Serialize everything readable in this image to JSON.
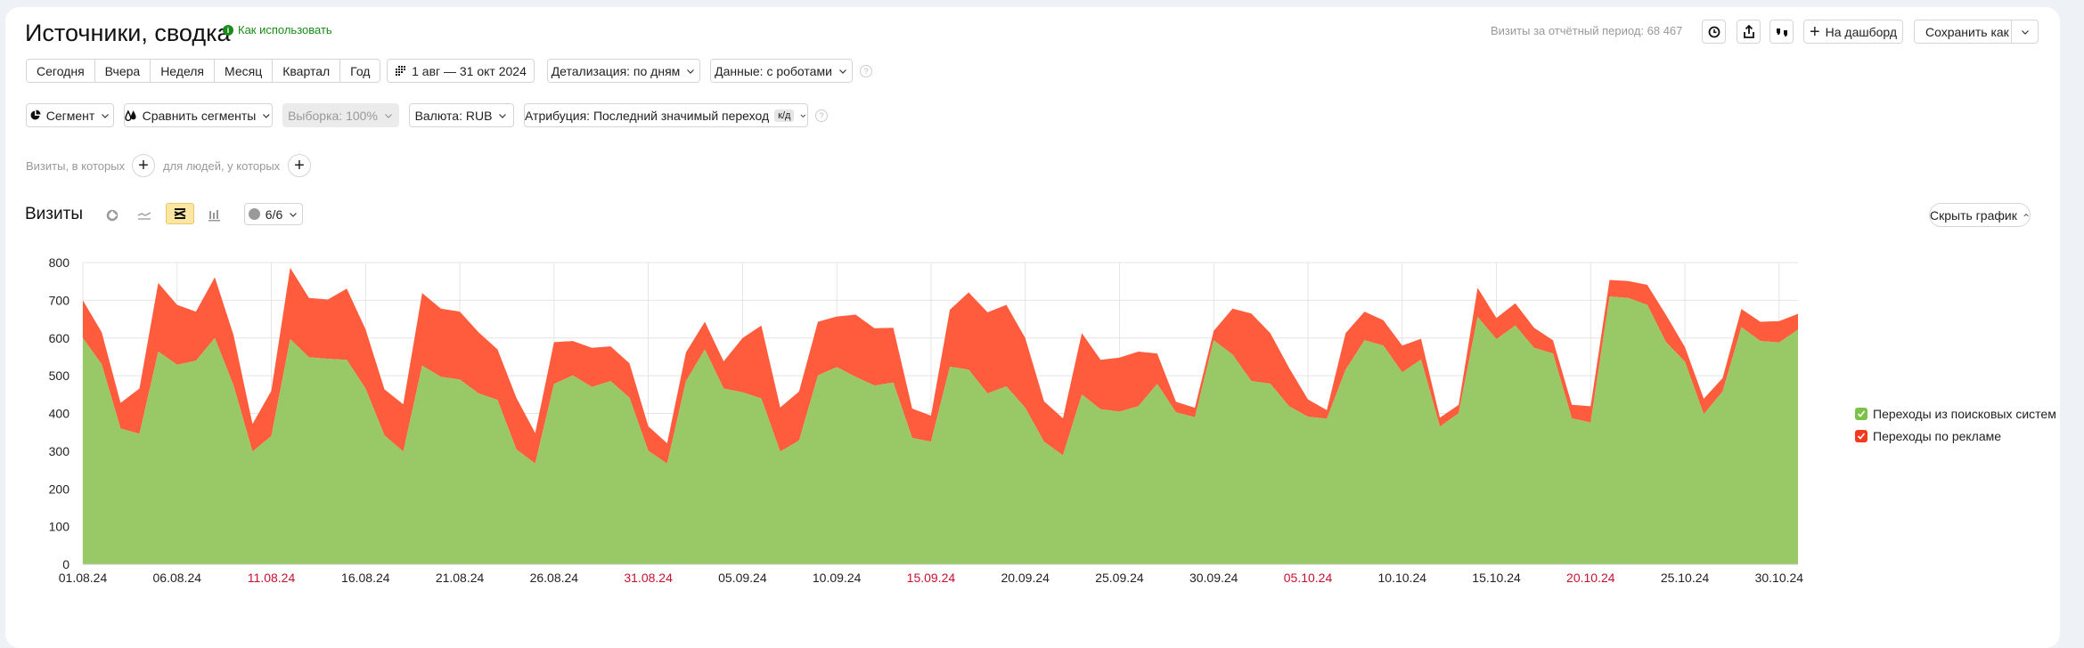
{
  "header": {
    "title": "Источники, сводка",
    "how_to_use": "Как использовать",
    "visits_total": "Визиты за отчётный период: 68 467",
    "add_dashboard": "На дашборд",
    "save_as": "Сохранить как"
  },
  "periods": [
    "Сегодня",
    "Вчера",
    "Неделя",
    "Месяц",
    "Квартал",
    "Год"
  ],
  "filters": {
    "date_range": "1 авг — 31 окт 2024",
    "detail": "Детализация: по дням",
    "data": "Данные: с роботами",
    "segment": "Сегмент",
    "compare": "Сравнить сегменты",
    "sample": "Выборка: 100%",
    "currency": "Валюта: RUB",
    "attribution": "Атрибуция: Последний значимый переход",
    "attribution_badge": "к/д",
    "help": "?"
  },
  "conditions": {
    "visits_where": "Визиты, в которых",
    "people_who": "для людей, у которых"
  },
  "chart_header": {
    "title": "Визиты",
    "comments": "6/6",
    "hide_chart": "Скрыть график",
    "active_view": "stacked-area"
  },
  "colors": {
    "search": "#99c966",
    "ads": "#ff5c3e",
    "holiday_label": "#c8102e",
    "accent": "#fbe7a1"
  },
  "chart_data": {
    "type": "area",
    "stacked": true,
    "ylim": [
      0,
      800
    ],
    "yticks": [
      0,
      100,
      200,
      300,
      400,
      500,
      600,
      700,
      800
    ],
    "grid": true,
    "legend_position": "right",
    "start_date": "01.08.24",
    "xtick_labels": [
      {
        "label": "01.08.24",
        "day": 0,
        "holiday": false
      },
      {
        "label": "06.08.24",
        "day": 5,
        "holiday": false
      },
      {
        "label": "11.08.24",
        "day": 10,
        "holiday": true
      },
      {
        "label": "16.08.24",
        "day": 15,
        "holiday": false
      },
      {
        "label": "21.08.24",
        "day": 20,
        "holiday": false
      },
      {
        "label": "26.08.24",
        "day": 25,
        "holiday": false
      },
      {
        "label": "31.08.24",
        "day": 30,
        "holiday": true
      },
      {
        "label": "05.09.24",
        "day": 35,
        "holiday": false
      },
      {
        "label": "10.09.24",
        "day": 40,
        "holiday": false
      },
      {
        "label": "15.09.24",
        "day": 45,
        "holiday": true
      },
      {
        "label": "20.09.24",
        "day": 50,
        "holiday": false
      },
      {
        "label": "25.09.24",
        "day": 55,
        "holiday": false
      },
      {
        "label": "30.09.24",
        "day": 60,
        "holiday": false
      },
      {
        "label": "05.10.24",
        "day": 65,
        "holiday": true
      },
      {
        "label": "10.10.24",
        "day": 70,
        "holiday": false
      },
      {
        "label": "15.10.24",
        "day": 75,
        "holiday": false
      },
      {
        "label": "20.10.24",
        "day": 80,
        "holiday": true
      },
      {
        "label": "25.10.24",
        "day": 85,
        "holiday": false
      },
      {
        "label": "30.10.24",
        "day": 90,
        "holiday": false
      }
    ],
    "series": [
      {
        "name": "Переходы из поисковых систем",
        "values": [
          600,
          530,
          360,
          346,
          564,
          529,
          540,
          600,
          474,
          299,
          340,
          597,
          549,
          545,
          542,
          466,
          342,
          299,
          527,
          497,
          490,
          453,
          436,
          305,
          267,
          478,
          501,
          470,
          486,
          442,
          301,
          267,
          486,
          570,
          466,
          456,
          440,
          299,
          328,
          501,
          523,
          497,
          474,
          482,
          335,
          325,
          524,
          516,
          453,
          472,
          415,
          325,
          289,
          450,
          411,
          405,
          419,
          478,
          403,
          390,
          594,
          556,
          486,
          479,
          419,
          391,
          386,
          516,
          594,
          580,
          509,
          543,
          365,
          401,
          656,
          597,
          633,
          574,
          559,
          387,
          376,
          710,
          706,
          688,
          589,
          537,
          398,
          458,
          629,
          592,
          588,
          622
        ]
      },
      {
        "name": "Переходы по рекламе",
        "values": [
          100,
          85,
          68,
          120,
          182,
          159,
          130,
          161,
          133,
          73,
          120,
          189,
          157,
          157,
          189,
          157,
          122,
          125,
          192,
          181,
          180,
          162,
          134,
          137,
          81,
          111,
          91,
          104,
          92,
          91,
          65,
          54,
          76,
          73,
          72,
          144,
          193,
          117,
          130,
          142,
          134,
          165,
          152,
          145,
          78,
          69,
          151,
          205,
          215,
          216,
          185,
          107,
          98,
          163,
          131,
          143,
          145,
          81,
          28,
          25,
          25,
          122,
          179,
          134,
          102,
          46,
          23,
          97,
          76,
          67,
          71,
          55,
          24,
          22,
          77,
          56,
          59,
          53,
          35,
          36,
          43,
          44,
          45,
          53,
          72,
          39,
          41,
          36,
          48,
          51,
          57,
          42
        ]
      }
    ]
  }
}
